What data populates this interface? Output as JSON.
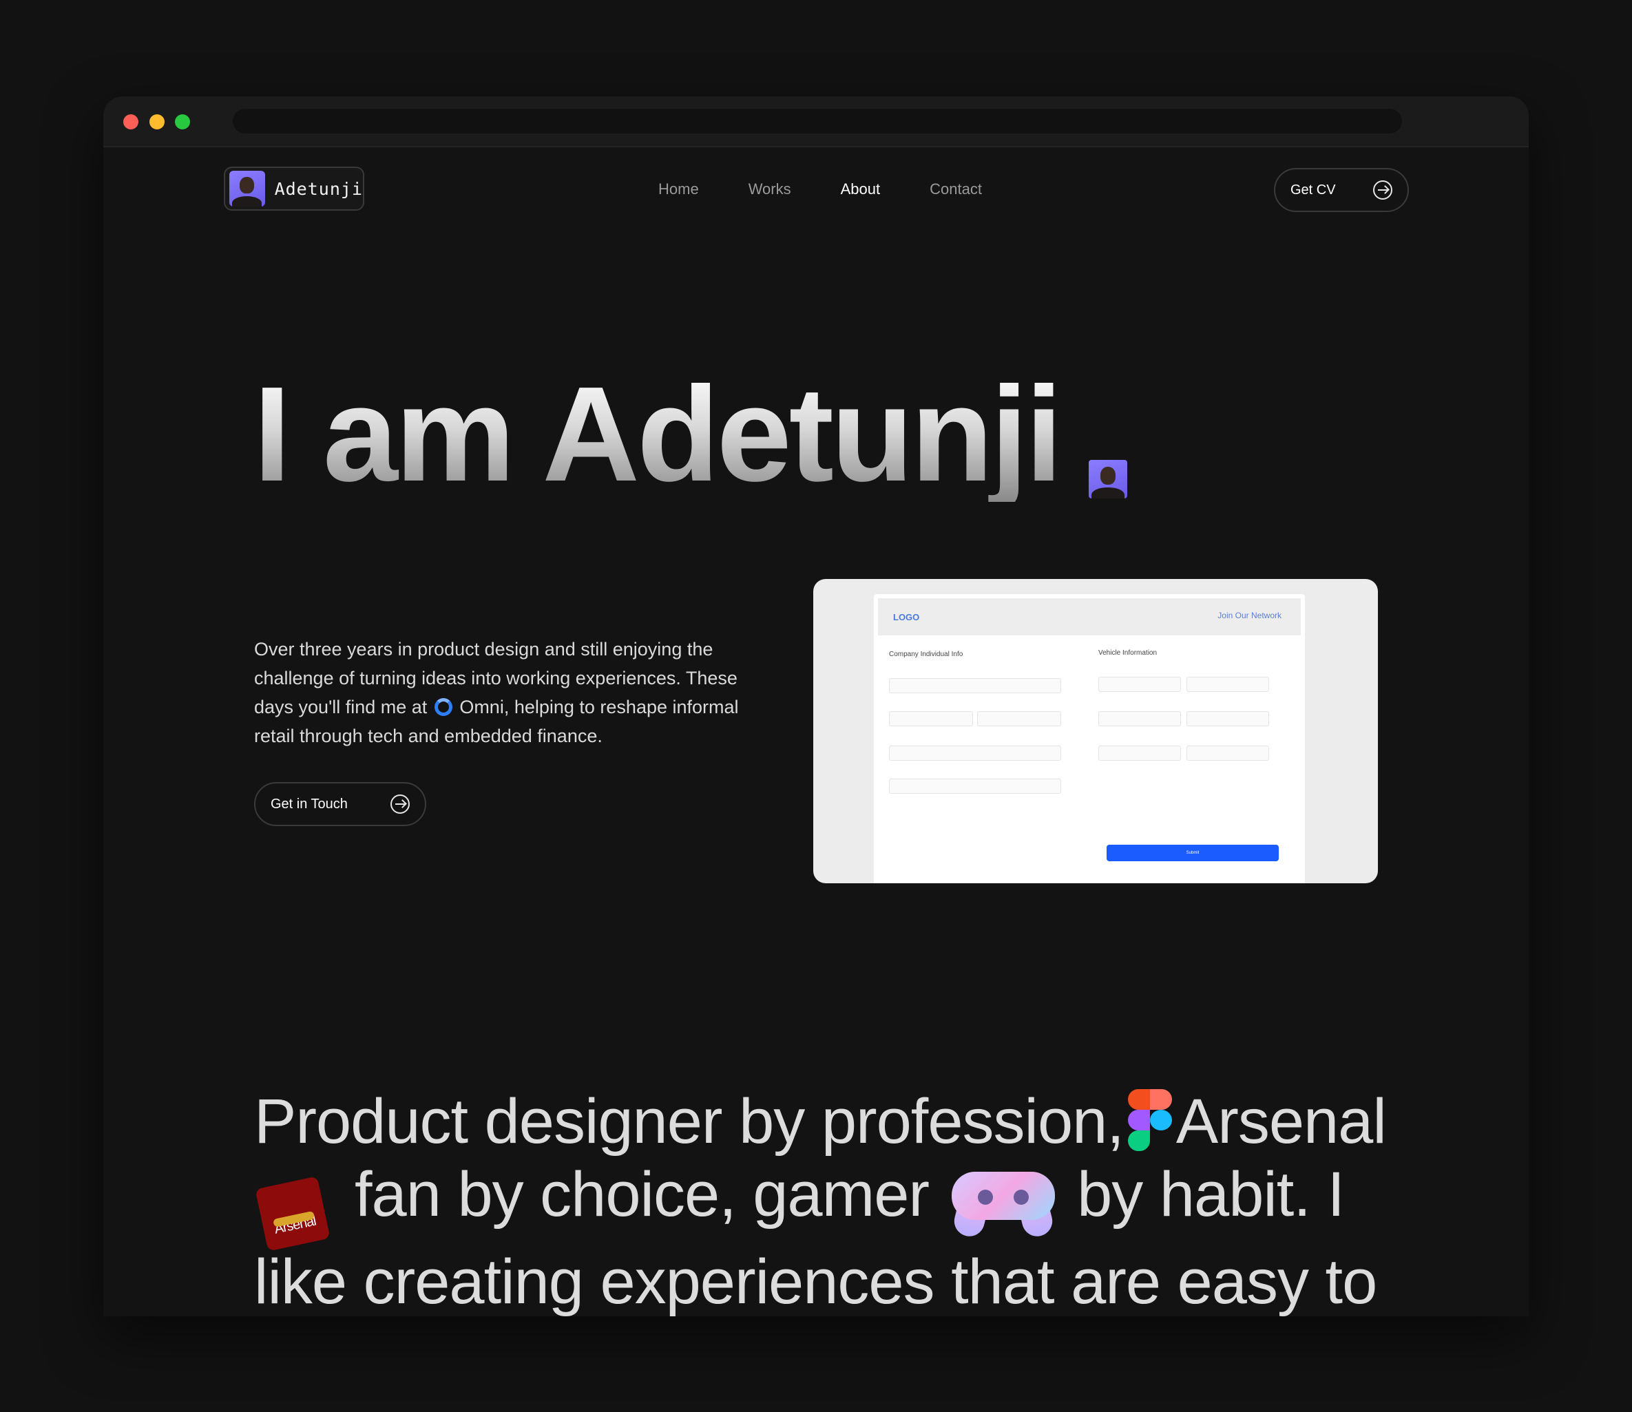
{
  "brand": {
    "name": "Adetunji"
  },
  "nav": {
    "items": [
      "Home",
      "Works",
      "About",
      "Contact"
    ],
    "active": "About"
  },
  "header": {
    "cta_label": "Get CV"
  },
  "hero": {
    "title": "I am Adetunji",
    "intro_before": "Over three years in product design and still enjoying the challenge of turning ideas into working experiences. These days you'll find me at",
    "intro_after": "Omni, helping to reshape informal retail through tech and embedded finance.",
    "cta_label": "Get in Touch"
  },
  "preview": {
    "logo": "LOGO",
    "join": "Join Our Network",
    "section_left": "Company  Individual Info",
    "section_right": "Vehicle Information",
    "submit": "Submit"
  },
  "statement": {
    "part1": "Product designer by profession,",
    "part2": "Arsenal",
    "part3": "fan by choice, gamer",
    "part4": "by habit. I like creating experiences that are easy to",
    "badge_text": "Arsenal"
  },
  "icons": [
    "avatar-photo",
    "arrow-right-circle-icon",
    "omni-logo-icon",
    "figma-logo-icon",
    "arsenal-badge-icon",
    "gamepad-icon"
  ],
  "colors": {
    "background": "#121212",
    "accent": "#1a5cff",
    "text": "#dcdcdc"
  }
}
